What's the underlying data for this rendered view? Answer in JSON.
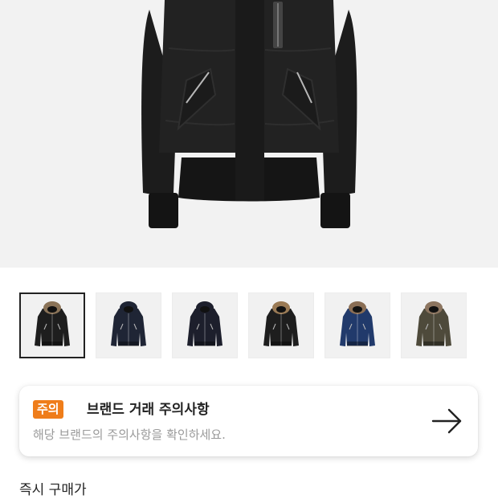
{
  "product": {
    "main_image_alt": "black down bomber jacket",
    "thumbnails": [
      {
        "color": "#1e1e1e",
        "fur": true,
        "fur_color": "#8a7358",
        "selected": true
      },
      {
        "color": "#1f2535",
        "fur": false,
        "selected": false
      },
      {
        "color": "#1d1f2c",
        "fur": false,
        "selected": false
      },
      {
        "color": "#1e1e1e",
        "fur": true,
        "fur_color": "#9a7a55",
        "selected": false
      },
      {
        "color": "#213a6b",
        "fur": true,
        "fur_color": "#8a6e55",
        "selected": false
      },
      {
        "color": "#4e4a3b",
        "fur": true,
        "fur_color": "#8c7560",
        "selected": false
      }
    ]
  },
  "notice": {
    "badge": "주의",
    "title": "브랜드 거래 주의사항",
    "description": "해당 브랜드의 주의사항을 확인하세요.",
    "badge_color": "#ef7d1a"
  },
  "price_section": {
    "title": "즉시 구매가"
  }
}
